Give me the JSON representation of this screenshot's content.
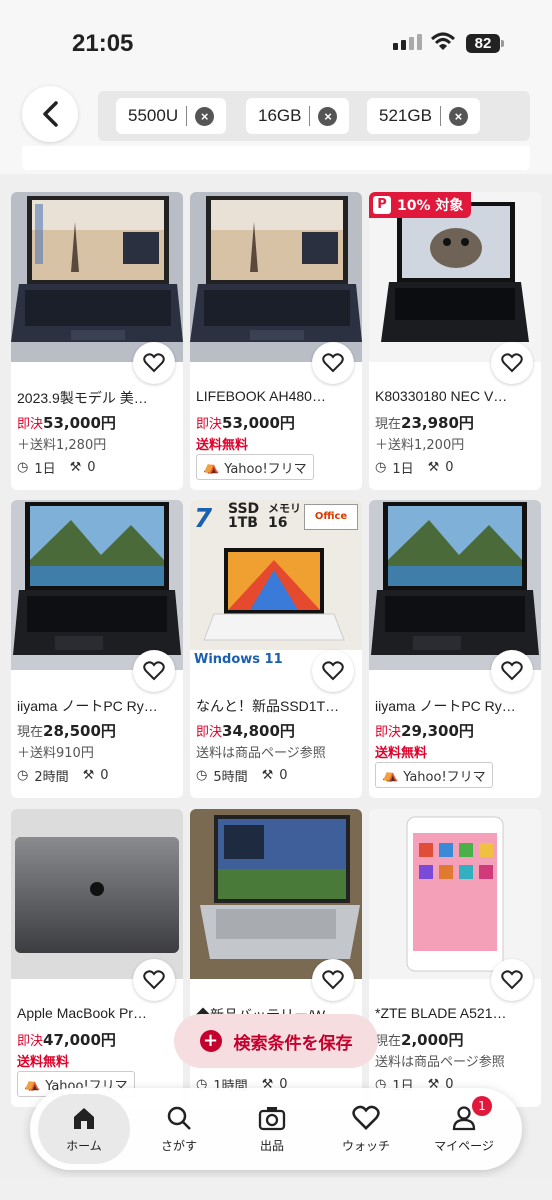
{
  "status": {
    "time": "21:05",
    "battery": "82"
  },
  "search": {
    "chips": [
      {
        "label": "5500U"
      },
      {
        "label": "16GB"
      },
      {
        "label": "521GB"
      }
    ]
  },
  "items": [
    {
      "title": "2023.9製モデル 美…",
      "price_label": "即決",
      "price": "53,000円",
      "shipping": "＋送料1,280円",
      "time_left": "1日",
      "bids": "0"
    },
    {
      "title": "LIFEBOOK AH480…",
      "price_label": "即決",
      "price": "53,000円",
      "shipping": "送料無料",
      "flea": "Yahoo!フリマ"
    },
    {
      "title": "K80330180 NEC V…",
      "price_label": "現在",
      "price": "23,980円",
      "shipping": "＋送料1,200円",
      "time_left": "1日",
      "bids": "0",
      "badge": "10% 対象"
    },
    {
      "title": "iiyama ノートPC Ry…",
      "price_label": "現在",
      "price": "28,500円",
      "shipping": "＋送料910円",
      "time_left": "2時間",
      "bids": "0"
    },
    {
      "title": "なんと！新品SSD1T…",
      "price_label": "即決",
      "price": "34,800円",
      "shipping": "送料は商品ページ参照",
      "time_left": "5時間",
      "bids": "0"
    },
    {
      "title": "iiyama ノートPC Ry…",
      "price_label": "即決",
      "price": "29,300円",
      "shipping": "送料無料",
      "flea": "Yahoo!フリマ"
    },
    {
      "title": "Apple MacBook Pr…",
      "price_label": "即決",
      "price": "47,000円",
      "shipping": "送料無料",
      "flea": "Yahoo!フリマ"
    },
    {
      "title": "◆新品バッテリー/W…",
      "price_label": "",
      "price": "",
      "shipping": "",
      "time_left": "1時間",
      "bids": "0"
    },
    {
      "title": "*ZTE BLADE A521…",
      "price_label": "現在",
      "price": "2,000円",
      "shipping": "送料は商品ページ参照",
      "time_left": "1日",
      "bids": "0"
    }
  ],
  "img_text": {
    "ssd": "SSD",
    "ssd_size": "1TB",
    "mem": "メモリ",
    "mem_size": "16",
    "office": "Office",
    "win": "Windows 11",
    "core": "7"
  },
  "save_search": "検索条件を保存",
  "nav": {
    "home": "ホーム",
    "search": "さがす",
    "sell": "出品",
    "watch": "ウォッチ",
    "mypage": "マイページ",
    "badge": "1"
  }
}
